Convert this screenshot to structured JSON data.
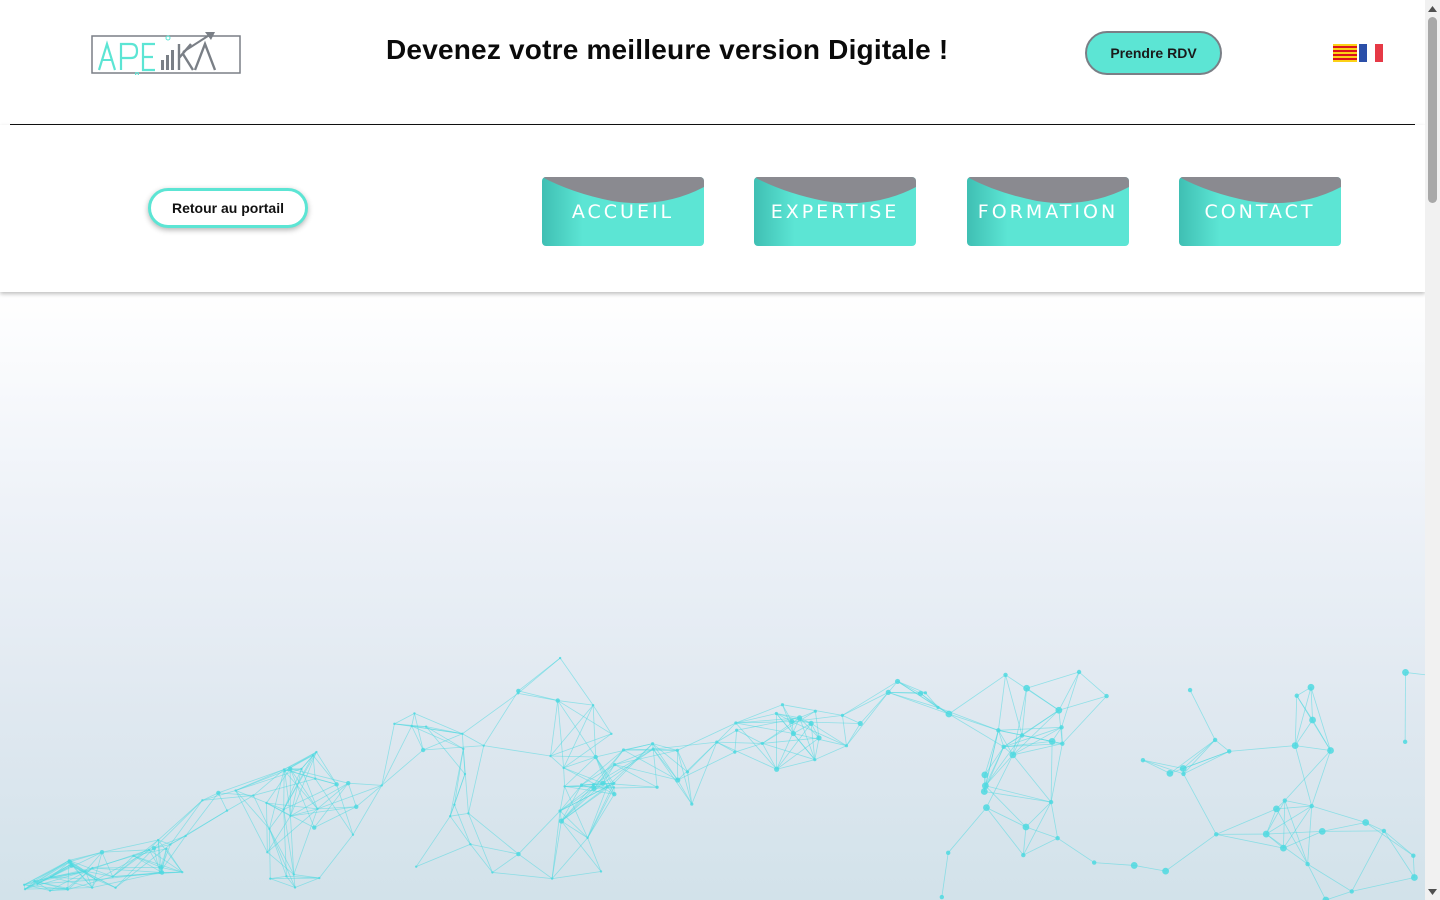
{
  "header": {
    "logo_text": "APEIKA",
    "tagline": "Devenez votre meilleure version Digitale !",
    "rdv_label": "Prendre RDV",
    "languages": [
      {
        "icon": "catalan-flag-icon"
      },
      {
        "icon": "french-flag-icon"
      }
    ]
  },
  "nav": {
    "portal_label": "Retour au portail",
    "items": [
      {
        "label": "ACCUEIL"
      },
      {
        "label": "EXPERTISE"
      },
      {
        "label": "FORMATION"
      },
      {
        "label": "CONTACT"
      }
    ]
  },
  "colors": {
    "accent": "#5ce5d4",
    "nav_top": "#8a8a90",
    "network": "#4fd9e0"
  }
}
